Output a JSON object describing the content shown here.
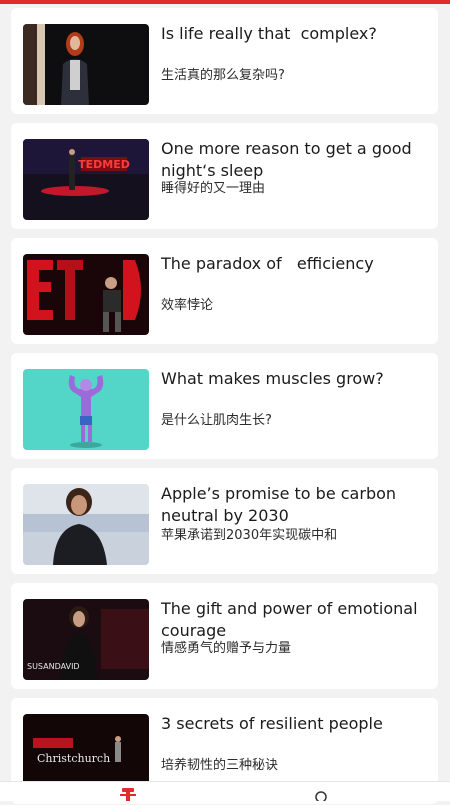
{
  "accent_color": "#e22b2b",
  "talks": [
    {
      "title": "Is life really that  complex?",
      "subtitle": "生活真的那么复杂吗?",
      "thumbnail_icon": "speaker-woman-red-hair-thumbnail"
    },
    {
      "title": "One more reason to get a good night‘s sleep",
      "subtitle": "睡得好的又一理由",
      "thumbnail_icon": "tedmed-stage-thumbnail",
      "thumb_text": "TEDMED"
    },
    {
      "title": "The paradox of   efficiency",
      "subtitle": "效率悖论",
      "thumbnail_icon": "ted-stage-man-thumbnail"
    },
    {
      "title": "What makes muscles grow?",
      "subtitle": "是什么让肌肉生长?",
      "thumbnail_icon": "muscle-cartoon-thumbnail"
    },
    {
      "title": "Apple’s promise to be carbon neutral by 2030",
      "subtitle": "苹果承诺到2030年实现碳中和",
      "thumbnail_icon": "woman-portrait-thumbnail"
    },
    {
      "title": "The gift and power of emotional courage",
      "subtitle": "情感勇气的赠予与力量",
      "thumbnail_icon": "susan-david-stage-thumbnail",
      "thumb_text": "SUSANDAVID"
    },
    {
      "title": "3 secrets of resilient people",
      "subtitle": "培养韧性的三种秘诀",
      "thumbnail_icon": "tedx-christchurch-thumbnail",
      "thumb_text": "Christchurch"
    }
  ],
  "bottom_nav": {
    "items": [
      {
        "icon": "home-ted-icon",
        "active": true
      },
      {
        "icon": "search-icon",
        "active": false
      }
    ]
  }
}
